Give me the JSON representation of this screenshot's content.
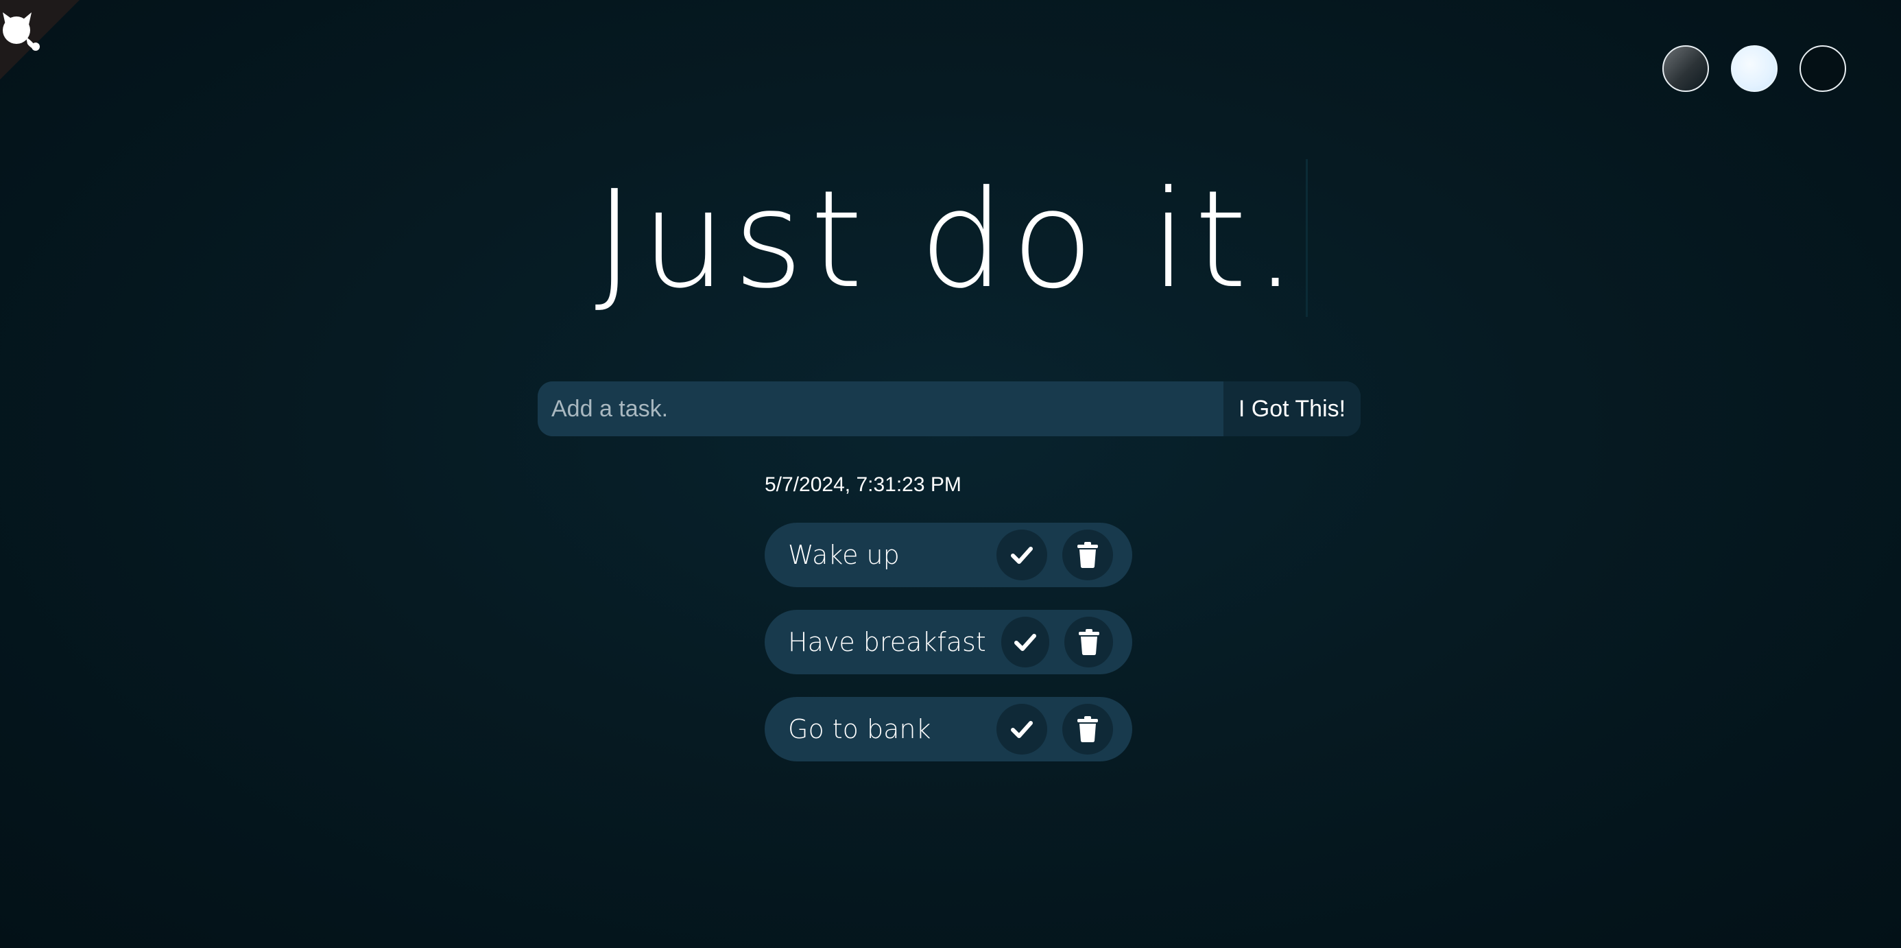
{
  "header": {
    "title": "Just do it."
  },
  "theme_selector": {
    "options": [
      "standard",
      "light",
      "darker"
    ]
  },
  "form": {
    "placeholder": "Add a task.",
    "input_value": "",
    "submit_label": "I Got This!"
  },
  "datetime": "5/7/2024, 7:31:23 PM",
  "todos": [
    {
      "text": "Wake up"
    },
    {
      "text": "Have breakfast"
    },
    {
      "text": "Go to bank"
    }
  ],
  "icons": {
    "corner": "github-octocat-icon",
    "check": "check-icon",
    "delete": "trash-icon"
  },
  "colors": {
    "background": "#061a22",
    "item_background": "#183a4d",
    "button_background": "#0f2937",
    "text": "#ffffff"
  }
}
